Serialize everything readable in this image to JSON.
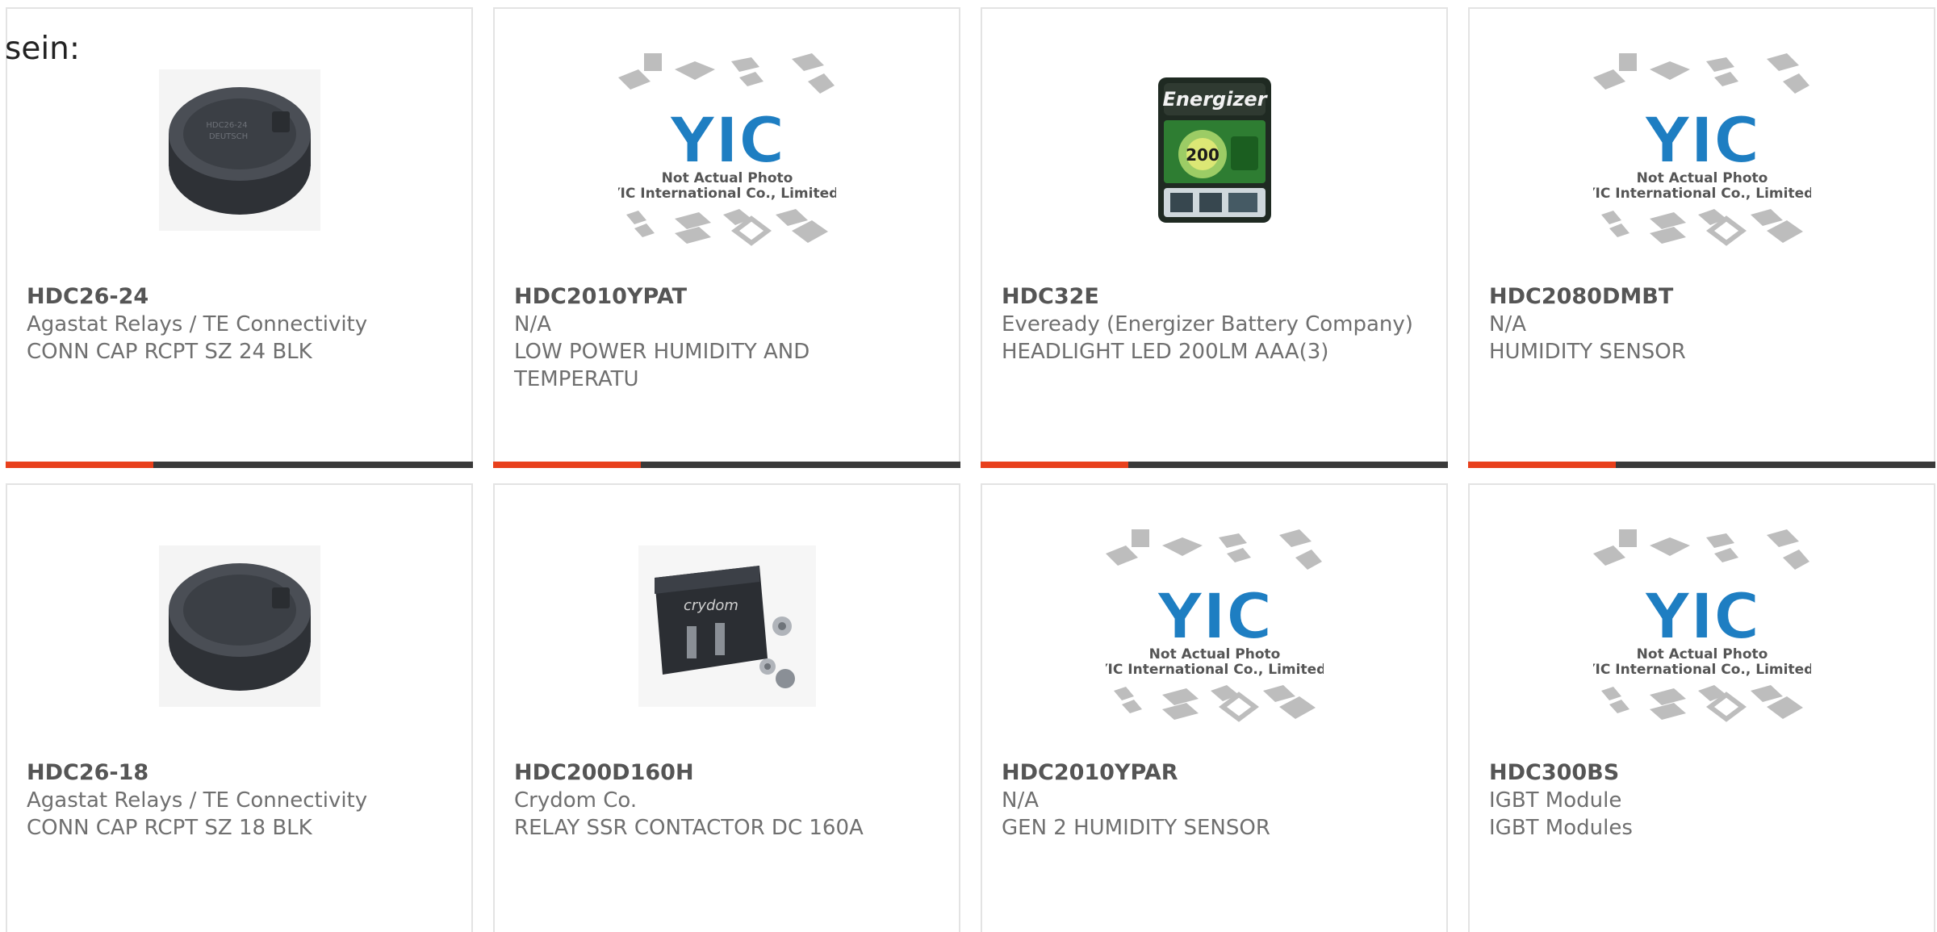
{
  "page_prefix": "sein:",
  "accent_color": "#e8401c",
  "bar_color": "#3a3a3a",
  "products": [
    {
      "part_number": "HDC26-24",
      "manufacturer": "Agastat Relays / TE Connectivity",
      "description": "CONN CAP RCPT SZ 24 BLK",
      "image": "connector-cap-image"
    },
    {
      "part_number": "HDC2010YPAT",
      "manufacturer": "N/A",
      "description": "LOW POWER HUMIDITY AND TEMPERATU",
      "image": "placeholder-not-actual-photo",
      "placeholder_line1": "Not Actual Photo",
      "placeholder_line2": "YIC International Co., Limited."
    },
    {
      "part_number": "HDC32E",
      "manufacturer": "Eveready (Energizer Battery Company)",
      "description": "HEADLIGHT LED 200LM AAA(3)",
      "image": "energizer-headlight-package",
      "package_brand": "Energizer",
      "package_number": "200"
    },
    {
      "part_number": "HDC2080DMBT",
      "manufacturer": "N/A",
      "description": "HUMIDITY SENSOR",
      "image": "placeholder-not-actual-photo",
      "placeholder_line1": "Not Actual Photo",
      "placeholder_line2": "YIC International Co., Limited."
    },
    {
      "part_number": "HDC26-18",
      "manufacturer": "Agastat Relays / TE Connectivity",
      "description": "CONN CAP RCPT SZ 18 BLK",
      "image": "connector-cap-image"
    },
    {
      "part_number": "HDC200D160H",
      "manufacturer": "Crydom Co.",
      "description": "RELAY SSR CONTACTOR DC 160A",
      "image": "solid-state-relay-image",
      "relay_brand": "crydom"
    },
    {
      "part_number": "HDC2010YPAR",
      "manufacturer": "N/A",
      "description": "GEN 2 HUMIDITY SENSOR",
      "image": "placeholder-not-actual-photo",
      "placeholder_line1": "Not Actual Photo",
      "placeholder_line2": "YIC International Co., Limited."
    },
    {
      "part_number": "HDC300BS",
      "manufacturer": "IGBT Module",
      "description": "IGBT Modules",
      "image": "placeholder-not-actual-photo",
      "placeholder_line1": "Not Actual Photo",
      "placeholder_line2": "YIC International Co., Limited."
    }
  ]
}
